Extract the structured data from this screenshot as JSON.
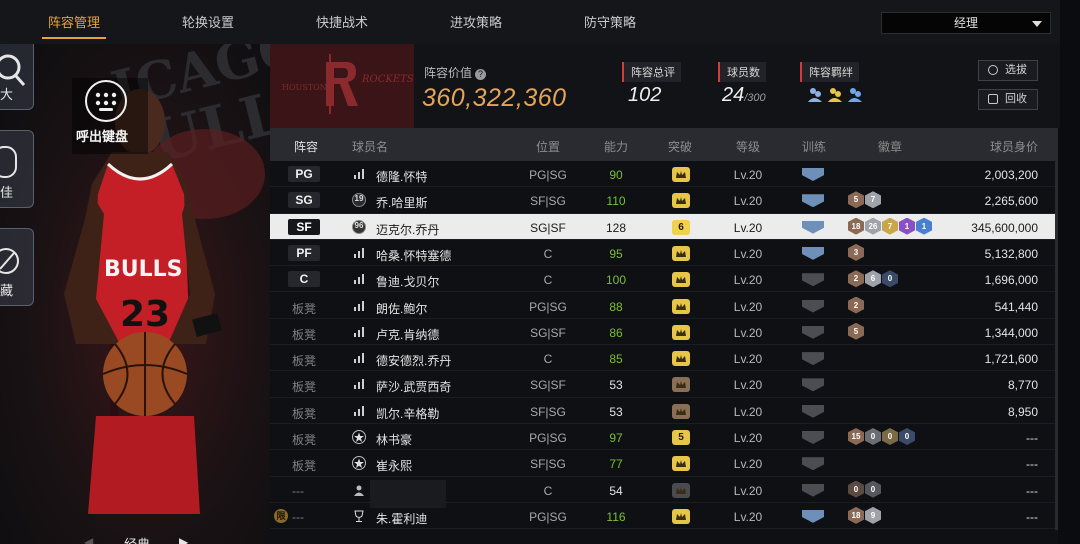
{
  "nav": {
    "tabs": [
      "阵容管理",
      "轮换设置",
      "快捷战术",
      "进攻策略",
      "防守策略"
    ],
    "active_index": 0,
    "manager_select": "经理"
  },
  "left": {
    "keyboard_label": "呼出键盘",
    "side_buttons": [
      "大",
      "佳",
      "藏"
    ],
    "style_label": "经典",
    "background_text": [
      "ICAGO",
      "ULLS"
    ],
    "jersey_text": "BULLS",
    "jersey_number": "23"
  },
  "team": {
    "logo_text": "ROCKETS",
    "logo_subtext": "HOUSTON",
    "value_label": "阵容价值",
    "value": "360,322,360",
    "overall_label": "阵容总评",
    "overall": "102",
    "count_label": "球员数",
    "count": "24",
    "count_max": "/300",
    "chem_label": "阵容羁绊",
    "btn_select": "选拔",
    "btn_recycle": "回收"
  },
  "table": {
    "headers": [
      "阵容",
      "球员名",
      "位置",
      "能力",
      "突破",
      "等级",
      "训练",
      "徽章",
      "球员身价"
    ],
    "rows": [
      {
        "slot": "PG",
        "bench": false,
        "type_icon": "bars",
        "name": "德隆.怀特",
        "pos": "PG|SG",
        "rating": "90",
        "rating_color": "#7bbf34",
        "break": "",
        "break_color": "#e7c548",
        "level": "Lv.20",
        "train": "#6d8fb8",
        "badges": [],
        "value": "2,003,200"
      },
      {
        "slot": "SG",
        "bench": false,
        "type_icon": "num19",
        "type_text": "19",
        "name": "乔.哈里斯",
        "pos": "SF|SG",
        "rating": "110",
        "rating_color": "#7bbf34",
        "break": "",
        "break_color": "#e7c548",
        "level": "Lv.20",
        "train": "#6d8fb8",
        "badges": [
          {
            "t": "5",
            "c": "#8a6a55"
          },
          {
            "t": "7",
            "c": "#9ea3ab"
          }
        ],
        "value": "2,265,600"
      },
      {
        "slot": "SF",
        "bench": false,
        "selected": true,
        "type_icon": "num96",
        "type_text": "96",
        "name": "迈克尔.乔丹",
        "pos": "SG|SF",
        "rating": "128",
        "rating_color": "#1a1a1a",
        "break": "6",
        "break_color": "#f0d24a",
        "level": "Lv.20",
        "train": "#6d8fb8",
        "badges": [
          {
            "t": "18",
            "c": "#8a6a55"
          },
          {
            "t": "26",
            "c": "#9ea3ab"
          },
          {
            "t": "7",
            "c": "#c9a64a"
          },
          {
            "t": "1",
            "c": "#8a4fc2"
          },
          {
            "t": "1",
            "c": "#4a7ed0"
          }
        ],
        "value": "345,600,000"
      },
      {
        "slot": "PF",
        "bench": false,
        "type_icon": "bars",
        "name": "哈桑.怀特塞德",
        "pos": "C",
        "rating": "95",
        "rating_color": "#7bbf34",
        "break": "",
        "break_color": "#e7c548",
        "level": "Lv.20",
        "train": "#6d8fb8",
        "badges": [
          {
            "t": "3",
            "c": "#8a6a55"
          }
        ],
        "value": "5,132,800"
      },
      {
        "slot": "C",
        "bench": false,
        "type_icon": "bars",
        "name": "鲁迪.戈贝尔",
        "pos": "C",
        "rating": "100",
        "rating_color": "#7bbf34",
        "break": "",
        "break_color": "#e7c548",
        "level": "Lv.20",
        "train": "#4b4d53",
        "badges": [
          {
            "t": "2",
            "c": "#8a6a55"
          },
          {
            "t": "6",
            "c": "#9ea3ab"
          },
          {
            "t": "0",
            "c": "#3b4a66"
          }
        ],
        "value": "1,696,000"
      },
      {
        "slot": "板凳",
        "bench": true,
        "type_icon": "bars",
        "name": "朗佐.鲍尔",
        "pos": "PG|SG",
        "rating": "88",
        "rating_color": "#7bbf34",
        "break": "",
        "break_color": "#e7c548",
        "level": "Lv.20",
        "train": "#4b4d53",
        "badges": [
          {
            "t": "2",
            "c": "#8a6a55"
          }
        ],
        "value": "541,440"
      },
      {
        "slot": "板凳",
        "bench": true,
        "type_icon": "bars",
        "name": "卢克.肯纳德",
        "pos": "SG|SF",
        "rating": "86",
        "rating_color": "#7bbf34",
        "break": "",
        "break_color": "#e7c548",
        "level": "Lv.20",
        "train": "#4b4d53",
        "badges": [
          {
            "t": "5",
            "c": "#8a6a55"
          }
        ],
        "value": "1,344,000"
      },
      {
        "slot": "板凳",
        "bench": true,
        "type_icon": "bars",
        "name": "德安德烈.乔丹",
        "pos": "C",
        "rating": "85",
        "rating_color": "#7bbf34",
        "break": "",
        "break_color": "#e7c548",
        "level": "Lv.20",
        "train": "#4b4d53",
        "badges": [],
        "value": "1,721,600"
      },
      {
        "slot": "板凳",
        "bench": true,
        "type_icon": "bars",
        "name": "萨沙.武贾西奇",
        "pos": "SG|SF",
        "rating": "53",
        "rating_color": "#e3e3e3",
        "break": "",
        "break_color": "#8a6e55",
        "level": "Lv.20",
        "train": "#4b4d53",
        "badges": [],
        "value": "8,770"
      },
      {
        "slot": "板凳",
        "bench": true,
        "type_icon": "bars",
        "name": "凯尔.辛格勒",
        "pos": "SF|SG",
        "rating": "53",
        "rating_color": "#e3e3e3",
        "break": "",
        "break_color": "#8a6e55",
        "level": "Lv.20",
        "train": "#4b4d53",
        "badges": [],
        "value": "8,950"
      },
      {
        "slot": "板凳",
        "bench": true,
        "type_icon": "star",
        "name": "林书豪",
        "pos": "PG|SG",
        "rating": "97",
        "rating_color": "#7bbf34",
        "break": "5",
        "break_color": "#e7c548",
        "level": "Lv.20",
        "train": "#4b4d53",
        "badges": [
          {
            "t": "15",
            "c": "#8a6a55"
          },
          {
            "t": "0",
            "c": "#6a6d73"
          },
          {
            "t": "0",
            "c": "#7a6a45"
          },
          {
            "t": "0",
            "c": "#3b4a66"
          }
        ],
        "value": "---"
      },
      {
        "slot": "板凳",
        "bench": true,
        "type_icon": "star",
        "name": "崔永熙",
        "pos": "SF|SG",
        "rating": "77",
        "rating_color": "#7bbf34",
        "break": "",
        "break_color": "#e7c548",
        "level": "Lv.20",
        "train": "#4b4d53",
        "badges": [],
        "value": "---"
      },
      {
        "slot": "---",
        "bench": true,
        "type_icon": "person",
        "name": "",
        "pos": "C",
        "rating": "54",
        "rating_color": "#e3e3e3",
        "break": "",
        "break_color": "#4a4b50",
        "level": "Lv.20",
        "train": "#4b4d53",
        "badges": [
          {
            "t": "0",
            "c": "#5a4a40"
          },
          {
            "t": "0",
            "c": "#55575c"
          }
        ],
        "value": "---"
      },
      {
        "slot": "---",
        "bench": true,
        "lock": "限",
        "type_icon": "trophy",
        "name": "朱.霍利迪",
        "pos": "PG|SG",
        "rating": "116",
        "rating_color": "#7bbf34",
        "break": "",
        "break_color": "#e7c548",
        "level": "Lv.20",
        "train": "#6d8fb8",
        "badges": [
          {
            "t": "18",
            "c": "#8a6a55"
          },
          {
            "t": "9",
            "c": "#9ea3ab"
          }
        ],
        "value": "---"
      }
    ]
  }
}
